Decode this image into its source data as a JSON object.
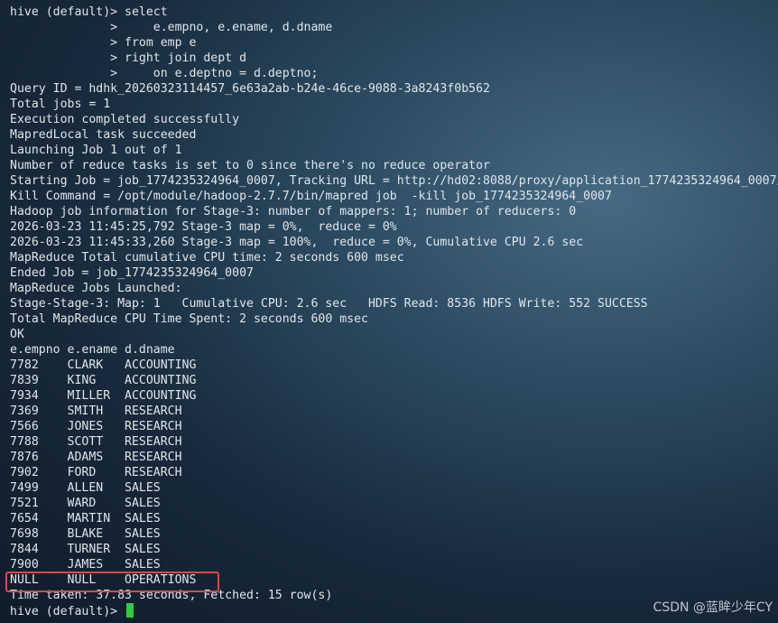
{
  "terminal": {
    "prompt": "hive (default)> ",
    "lines": [
      "hive (default)> select",
      "              >     e.empno, e.ename, d.dname",
      "              > from emp e",
      "              > right join dept d",
      "              >     on e.deptno = d.deptno;",
      "Query ID = hdhk_20260323114457_6e63a2ab-b24e-46ce-9088-3a8243f0b562",
      "Total jobs = 1",
      "Execution completed successfully",
      "MapredLocal task succeeded",
      "Launching Job 1 out of 1",
      "Number of reduce tasks is set to 0 since there's no reduce operator",
      "Starting Job = job_1774235324964_0007, Tracking URL = http://hd02:8088/proxy/application_1774235324964_0007/",
      "Kill Command = /opt/module/hadoop-2.7.7/bin/mapred job  -kill job_1774235324964_0007",
      "Hadoop job information for Stage-3: number of mappers: 1; number of reducers: 0",
      "2026-03-23 11:45:25,792 Stage-3 map = 0%,  reduce = 0%",
      "2026-03-23 11:45:33,260 Stage-3 map = 100%,  reduce = 0%, Cumulative CPU 2.6 sec",
      "MapReduce Total cumulative CPU time: 2 seconds 600 msec",
      "Ended Job = job_1774235324964_0007",
      "MapReduce Jobs Launched:",
      "Stage-Stage-3: Map: 1   Cumulative CPU: 2.6 sec   HDFS Read: 8536 HDFS Write: 552 SUCCESS",
      "Total MapReduce CPU Time Spent: 2 seconds 600 msec",
      "OK",
      "e.empno e.ename d.dname",
      "7782    CLARK   ACCOUNTING",
      "7839    KING    ACCOUNTING",
      "7934    MILLER  ACCOUNTING",
      "7369    SMITH   RESEARCH",
      "7566    JONES   RESEARCH",
      "7788    SCOTT   RESEARCH",
      "7876    ADAMS   RESEARCH",
      "7902    FORD    RESEARCH",
      "7499    ALLEN   SALES",
      "7521    WARD    SALES",
      "7654    MARTIN  SALES",
      "7698    BLAKE   SALES",
      "7844    TURNER  SALES",
      "7900    JAMES   SALES",
      "NULL    NULL    OPERATIONS",
      "Time taken: 37.83 seconds, Fetched: 15 row(s)"
    ]
  },
  "watermark": "CSDN @蓝眸少年CY",
  "colors": {
    "text": "#dfe5ea",
    "cursor": "#2ecc40",
    "highlight": "#e8434b"
  }
}
